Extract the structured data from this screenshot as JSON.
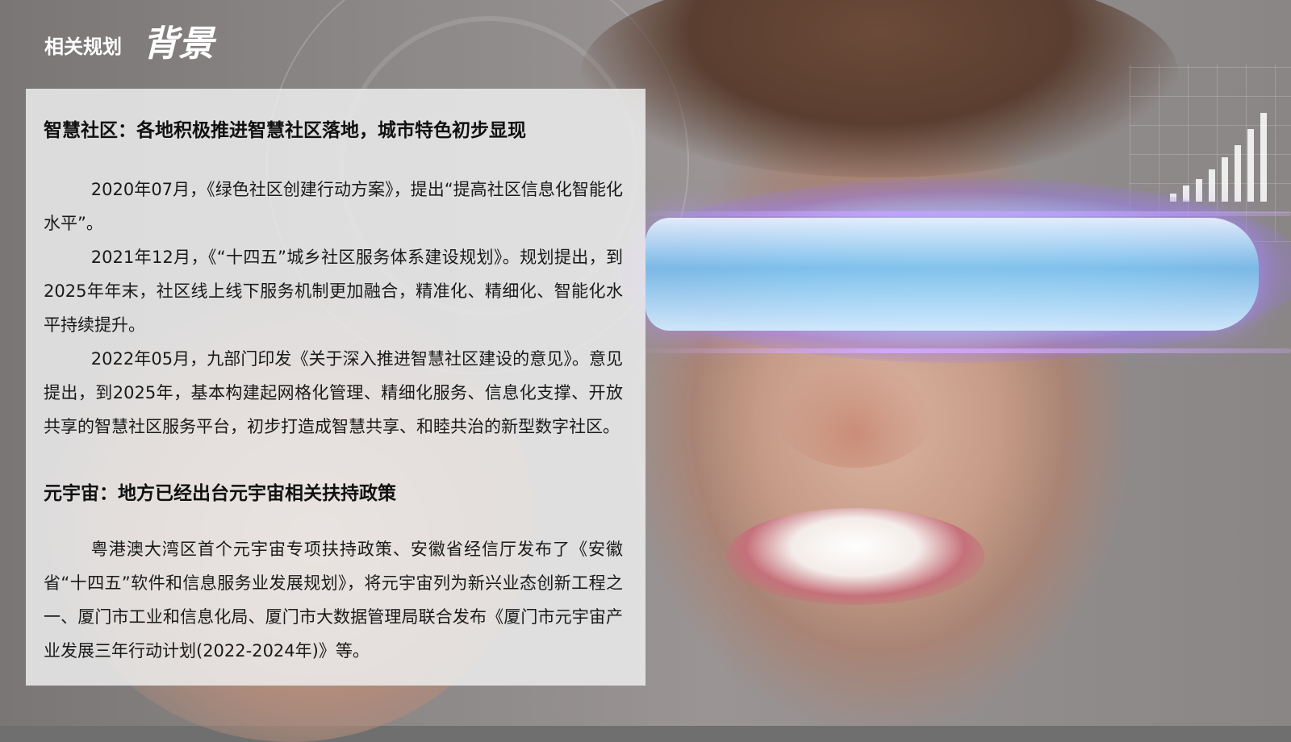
{
  "header": {
    "subtitle": "相关规划",
    "title": "背景"
  },
  "sections": [
    {
      "heading": "智慧社区：各地积极推进智慧社区落地，城市特色初步显现",
      "paragraphs": [
        "2020年07月，《绿色社区创建行动方案》，提出“提高社区信息化智能化水平”。",
        "2021年12月，《“十四五”城乡社区服务体系建设规划》。规划提出，到2025年年末，社区线上线下服务机制更加融合，精准化、精细化、智能化水平持续提升。",
        "2022年05月，九部门印发《关于深入推进智慧社区建设的意见》。意见提出，到2025年，基本构建起网格化管理、精细化服务、信息化支撑、开放共享的智慧社区服务平台，初步打造成智慧共享、和睦共治的新型数字社区。"
      ]
    },
    {
      "heading": "元宇宙：地方已经出台元宇宙相关扶持政策",
      "paragraphs": [
        "粤港澳大湾区首个元宇宙专项扶持政策、安徽省经信厅发布了《安徽省“十四五”软件和信息服务业发展规划》，将元宇宙列为新兴业态创新工程之一、厦门市工业和信息化局、厦门市大数据管理局联合发布《厦门市元宇宙产业发展三年行动计划(2022-2024年)》等。"
      ]
    }
  ],
  "colors": {
    "panel_bg": "#ececec",
    "header_text": "#ffffff",
    "body_text": "#1a1a1a"
  }
}
